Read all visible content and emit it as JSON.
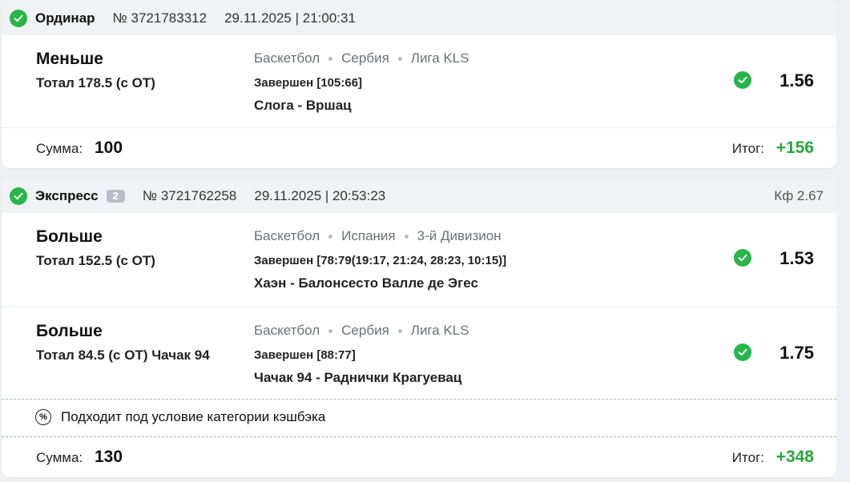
{
  "bets": [
    {
      "type": "Ординар",
      "number": "№ 3721783312",
      "date": "29.11.2025 | 21:00:31",
      "selections": [
        {
          "pick": "Меньше",
          "market": "Тотал 178.5 (с ОТ)",
          "sport": "Баскетбол",
          "country": "Сербия",
          "league": "Лига KLS",
          "status": "Завершен [105:66]",
          "teams": "Слога - Вршац",
          "odds": "1.56"
        }
      ],
      "sum_label": "Сумма:",
      "sum": "100",
      "result_label": "Итог:",
      "result": "+156"
    },
    {
      "type": "Экспресс",
      "badge": "2",
      "number": "№ 3721762258",
      "date": "29.11.2025 | 20:53:23",
      "coef": "Кф 2.67",
      "selections": [
        {
          "pick": "Больше",
          "market": "Тотал 152.5 (с ОТ)",
          "sport": "Баскетбол",
          "country": "Испания",
          "league": "3-й Дивизион",
          "status": "Завершен [78:79(19:17, 21:24, 28:23, 10:15)]",
          "teams": "Хаэн - Балонсесто Валле де Эгес",
          "odds": "1.53"
        },
        {
          "pick": "Больше",
          "market": "Тотал 84.5 (с ОТ) Чачак 94",
          "sport": "Баскетбол",
          "country": "Сербия",
          "league": "Лига KLS",
          "status": "Завершен [88:77]",
          "teams": "Чачак 94 - Раднички Крагуевац",
          "odds": "1.75"
        }
      ],
      "cashback_icon": "%",
      "cashback": "Подходит под условие категории кэшбэка",
      "sum_label": "Сумма:",
      "sum": "130",
      "result_label": "Итог:",
      "result": "+348"
    }
  ],
  "icons": {
    "status": "check-circle-icon",
    "cashback": "percent-circle-icon"
  },
  "colors": {
    "win_green": "#27b64a",
    "result_green": "#2aa53c",
    "header_bg": "#f1f2f5",
    "page_bg": "#eef0f3"
  }
}
